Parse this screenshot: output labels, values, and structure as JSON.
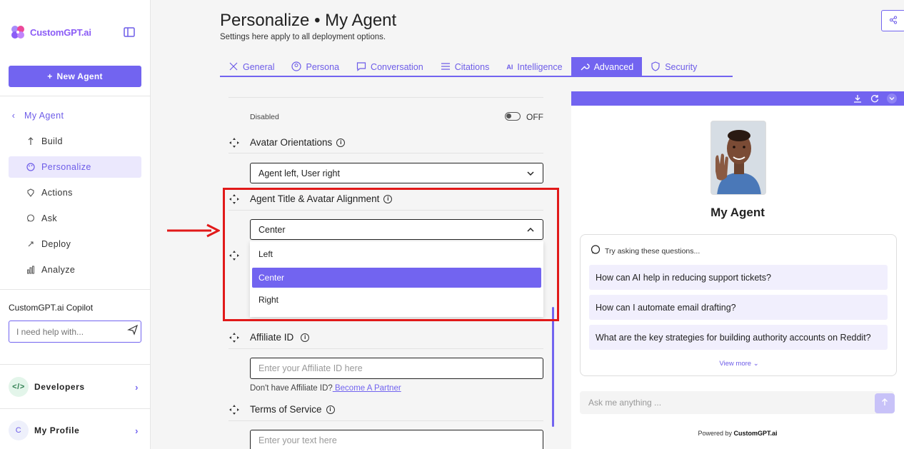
{
  "sidebar": {
    "brand": "CustomGPT.ai",
    "new_agent_label": "New Agent",
    "back_label": "My Agent",
    "items": [
      {
        "label": "Build",
        "icon": "build-icon"
      },
      {
        "label": "Personalize",
        "icon": "palette-icon"
      },
      {
        "label": "Actions",
        "icon": "actions-icon"
      },
      {
        "label": "Ask",
        "icon": "chat-icon"
      },
      {
        "label": "Deploy",
        "icon": "rocket-icon"
      },
      {
        "label": "Analyze",
        "icon": "chart-icon"
      }
    ],
    "copilot_label": "CustomGPT.ai Copilot",
    "copilot_placeholder": "I need help with...",
    "developers_label": "Developers",
    "profile_label": "My Profile",
    "profile_initial": "C"
  },
  "header": {
    "title": "Personalize • My Agent",
    "subtitle": "Settings here apply to all deployment options."
  },
  "tabs": [
    {
      "label": "General"
    },
    {
      "label": "Persona"
    },
    {
      "label": "Conversation"
    },
    {
      "label": "Citations"
    },
    {
      "label": "Intelligence"
    },
    {
      "label": "Advanced"
    },
    {
      "label": "Security"
    }
  ],
  "settings": {
    "disabled_label": "Disabled",
    "toggle_state": "OFF",
    "avatar_orientation": {
      "title": "Avatar Orientations",
      "value": "Agent left, User right"
    },
    "alignment": {
      "title": "Agent Title & Avatar Alignment",
      "value": "Center",
      "options": [
        "Left",
        "Center",
        "Right"
      ],
      "selected": "Center"
    },
    "affiliate": {
      "title": "Affiliate ID",
      "placeholder": "Enter your Affiliate ID here",
      "help_text": "Don't have Affiliate ID?",
      "link_text": " Become A Partner"
    },
    "terms": {
      "title": "Terms of Service",
      "placeholder": "Enter your text here"
    }
  },
  "preview": {
    "agent_name": "My Agent",
    "questions_heading": "Try asking these questions...",
    "questions": [
      "How can AI help in reducing support tickets?",
      "How can I automate email drafting?",
      "What are the key strategies for building authority accounts on Reddit?"
    ],
    "view_more": "View more",
    "ask_placeholder": "Ask me anything ...",
    "powered_prefix": "Powered by ",
    "powered_brand": "CustomGPT.ai"
  },
  "colors": {
    "accent": "#7264f0",
    "highlight": "#e11919"
  }
}
